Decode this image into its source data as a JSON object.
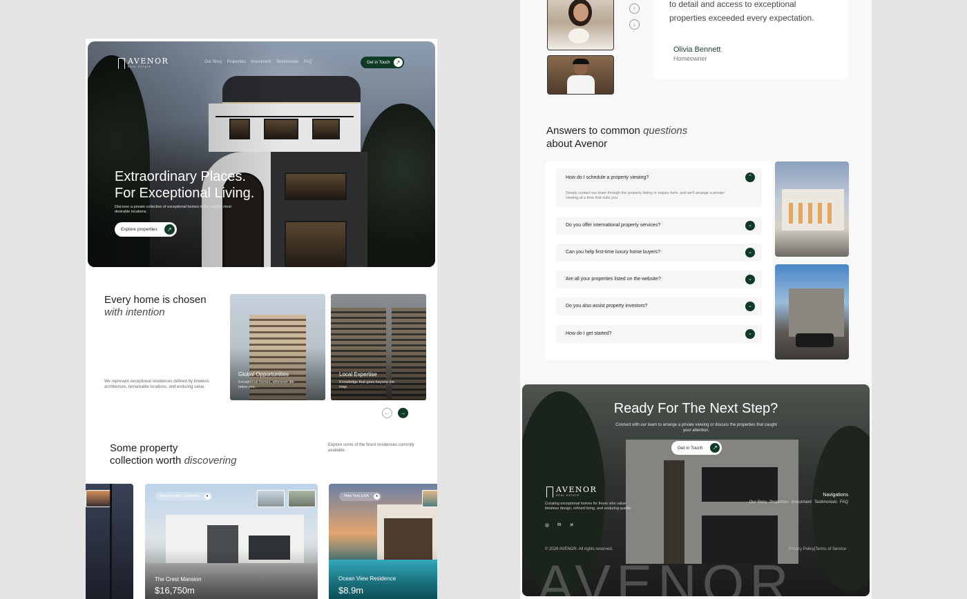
{
  "brand": {
    "name": "AVENOR",
    "tagline": "REAL ESTATE"
  },
  "nav": {
    "items": [
      "Our Story",
      "Properties",
      "Investment",
      "Testimonials",
      "FAQ"
    ],
    "cta": "Get in Touch"
  },
  "hero": {
    "title_line1": "Extraordinary Places.",
    "title_line2": "For Exceptional Living.",
    "subtitle": "Discover a private collection of exceptional homes in the world's most desirable locations.",
    "button": "Explore properties"
  },
  "intro": {
    "title_line1": "Every home is chosen",
    "title_line2": "with intention",
    "description": "We represent exceptional residences defined by timeless architecture, remarkable locations, and enduring value.",
    "cards": [
      {
        "title": "Global Opportunities",
        "subtitle": "Exceptional homes, wherever life takes you."
      },
      {
        "title": "Local Expertise",
        "subtitle": "Knowledge that goes beyond the map."
      }
    ]
  },
  "collection": {
    "title_line1": "Some property",
    "title_line2a": "collection worth",
    "title_line2b": "discovering",
    "description": "Explore some of the finest residences currently available.",
    "properties": [
      {
        "location": "",
        "name": "",
        "price": ""
      },
      {
        "location": "Beverly Hills, California",
        "name": "The Crest Mansion",
        "price": "$16,750m"
      },
      {
        "location": "New York,USA",
        "name": "Ocean View Residence",
        "price": "$8.9m"
      }
    ]
  },
  "testimonial": {
    "quote": "to detail and access to exceptional properties exceeded every expectation.",
    "name": "Olivia Bennett",
    "role": "Homeowner"
  },
  "faq": {
    "title_line1a": "Answers to common",
    "title_line1b": "questions",
    "title_line2": "about Avenor",
    "items": [
      {
        "q": "How do I schedule a property viewing?",
        "a": "Simply contact our team through the property listing or inquiry form, and we'll arrange a private viewing at a time that suits you.",
        "open": true
      },
      {
        "q": "Do you offer international property services?",
        "open": false
      },
      {
        "q": "Can you help first-time luxury home buyers?",
        "open": false
      },
      {
        "q": "Are all your properties listed on the website?",
        "open": false
      },
      {
        "q": "Do you also assist property investors?",
        "open": false
      },
      {
        "q": "How do I get started?",
        "open": false
      }
    ]
  },
  "cta": {
    "title": "Ready For The Next Step?",
    "subtitle": "Connect with our team to arrange a private viewing or discuss the properties that caught your attention.",
    "button": "Get in Touch"
  },
  "footer": {
    "description": "Curating exceptional homes for those who value timeless design, refined living, and enduring quality.",
    "nav_title": "Navigations",
    "nav_items": [
      "Our Story",
      "Properties",
      "Investment",
      "Testimonials",
      "FAQ"
    ],
    "socials": [
      "instagram-icon",
      "linkedin-icon",
      "x-icon"
    ],
    "copyright": "© 2026 AVENOR. All rights reserved.",
    "privacy": "Privacy Policy",
    "separator": "|",
    "terms": "Terms of Service",
    "watermark": "AVENOR"
  },
  "colors": {
    "accent": "#0e3a26",
    "background": "#e4e4e4",
    "panel": "#ffffff"
  }
}
